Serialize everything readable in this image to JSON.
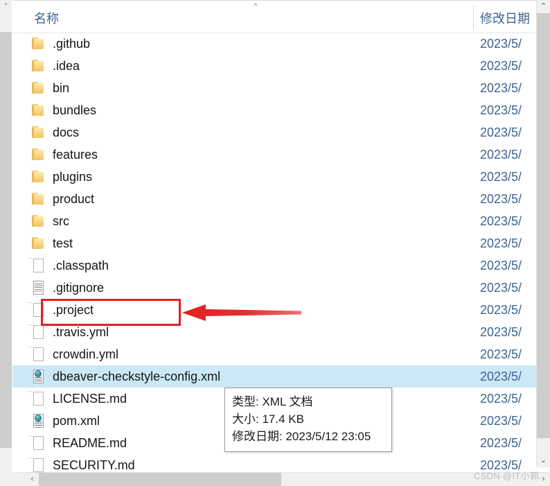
{
  "window": {
    "type": "file-explorer-list",
    "selection_highlight_color": "#cbe8f6",
    "header_text_color": "#3c6490"
  },
  "header": {
    "name_column": "名称",
    "date_column": "修改日期",
    "sort_caret": "^"
  },
  "files": [
    {
      "name": ".github",
      "icon": "folder",
      "date": "2023/5/",
      "selected": false
    },
    {
      "name": ".idea",
      "icon": "folder",
      "date": "2023/5/",
      "selected": false
    },
    {
      "name": "bin",
      "icon": "folder",
      "date": "2023/5/",
      "selected": false
    },
    {
      "name": "bundles",
      "icon": "folder",
      "date": "2023/5/",
      "selected": false
    },
    {
      "name": "docs",
      "icon": "folder",
      "date": "2023/5/",
      "selected": false
    },
    {
      "name": "features",
      "icon": "folder",
      "date": "2023/5/",
      "selected": false
    },
    {
      "name": "plugins",
      "icon": "folder",
      "date": "2023/5/",
      "selected": false
    },
    {
      "name": "product",
      "icon": "folder",
      "date": "2023/5/",
      "selected": false
    },
    {
      "name": "src",
      "icon": "folder",
      "date": "2023/5/",
      "selected": false
    },
    {
      "name": "test",
      "icon": "folder",
      "date": "2023/5/",
      "selected": false
    },
    {
      "name": ".classpath",
      "icon": "document",
      "date": "2023/5/",
      "selected": false
    },
    {
      "name": ".gitignore",
      "icon": "text-document",
      "date": "2023/5/",
      "selected": false
    },
    {
      "name": ".project",
      "icon": "document",
      "date": "2023/5/",
      "selected": false
    },
    {
      "name": ".travis.yml",
      "icon": "document",
      "date": "2023/5/",
      "selected": false
    },
    {
      "name": "crowdin.yml",
      "icon": "document",
      "date": "2023/5/",
      "selected": false
    },
    {
      "name": "dbeaver-checkstyle-config.xml",
      "icon": "xml-document",
      "date": "2023/5/",
      "selected": true
    },
    {
      "name": "LICENSE.md",
      "icon": "document",
      "date": "2023/5/",
      "selected": false
    },
    {
      "name": "pom.xml",
      "icon": "xml-document",
      "date": "2023/5/",
      "selected": false
    },
    {
      "name": "README.md",
      "icon": "document",
      "date": "2023/5/",
      "selected": false
    },
    {
      "name": "SECURITY.md",
      "icon": "document",
      "date": "2023/5/",
      "selected": false
    }
  ],
  "tooltip": {
    "type_line": "类型: XML 文档",
    "size_line": "大小: 17.4 KB",
    "modified_line": "修改日期: 2023/5/12 23:05"
  },
  "annotations": {
    "highlight_color": "#e22020",
    "highlight_target": ".project",
    "arrow_direction": "left"
  },
  "scrollbars": {
    "up_arrow": "⌃",
    "down_arrow": "⌄",
    "left_arrow": "‹",
    "right_arrow": "›"
  },
  "watermark": "CSDN @IT小郭."
}
